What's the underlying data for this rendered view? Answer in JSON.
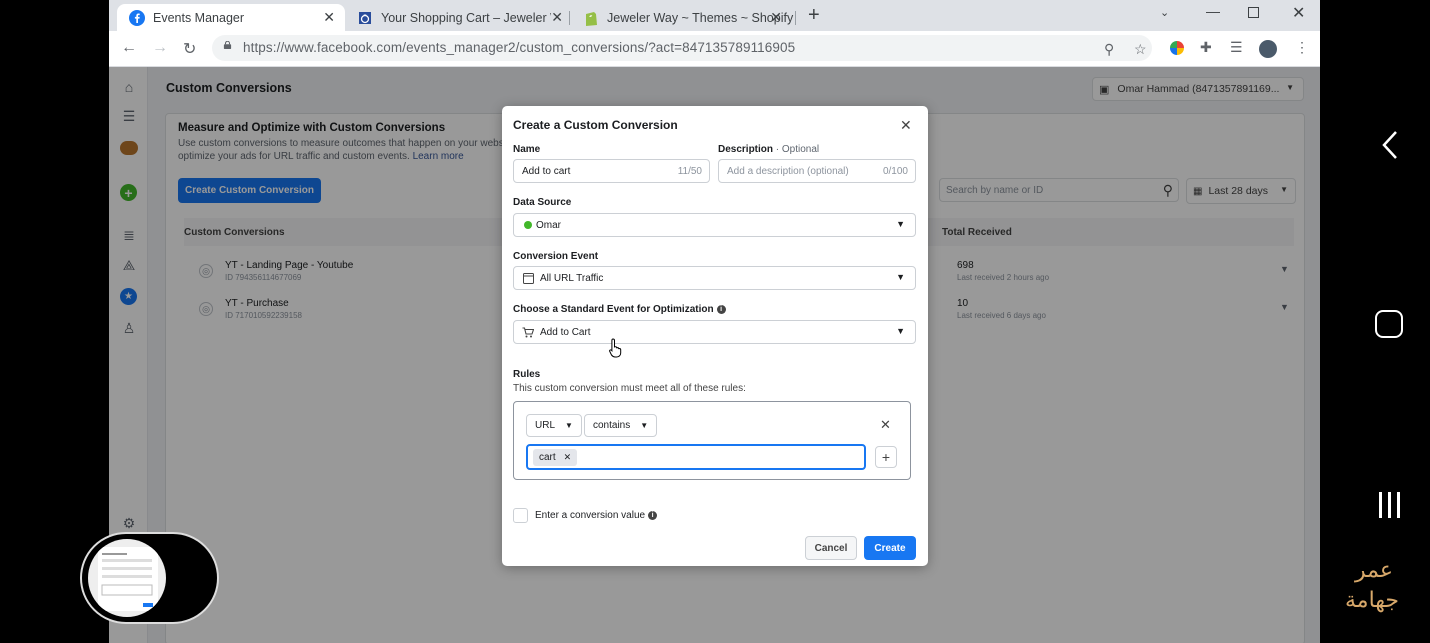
{
  "browser": {
    "tabs": [
      {
        "title": "Events Manager",
        "active": true,
        "icon": "facebook-icon"
      },
      {
        "title": "Your Shopping Cart – Jeweler Wa",
        "active": false,
        "icon": "ring-icon"
      },
      {
        "title": "Jeweler Way ~ Themes ~ Shopify",
        "active": false,
        "icon": "shopify-icon"
      }
    ],
    "url": "https://www.facebook.com/events_manager2/custom_conversions/?act=847135789116905"
  },
  "page": {
    "title": "Custom Conversions",
    "account": "Omar Hammad (8471357891169...",
    "banner": {
      "heading": "Measure and Optimize with Custom Conversions",
      "desc_line1": "Use custom conversions to measure outcomes that happen on your webs",
      "desc_line2": "optimize your ads for URL traffic and custom events.",
      "learn_more": "Learn more"
    },
    "create_button": "Create Custom Conversion",
    "search_placeholder": "Search by name or ID",
    "date_range": "Last 28 days",
    "table": {
      "col_name": "Custom Conversions",
      "col_total": "Total Received",
      "rows": [
        {
          "name": "YT - Landing Page - Youtube",
          "id": "ID 794356114677069",
          "total": "698",
          "last": "Last received 2 hours ago"
        },
        {
          "name": "YT - Purchase",
          "id": "ID 717010592239158",
          "total": "10",
          "last": "Last received 6 days ago"
        }
      ]
    }
  },
  "modal": {
    "title": "Create a Custom Conversion",
    "name_label": "Name",
    "name_value": "Add to cart",
    "name_count": "11/50",
    "desc_label": "Description",
    "desc_optional": " · Optional",
    "desc_placeholder": "Add a description (optional)",
    "desc_count": "0/100",
    "source_label": "Data Source",
    "source_value": "Omar",
    "event_label": "Conversion Event",
    "event_value": "All URL Traffic",
    "standard_label": "Choose a Standard Event for Optimization",
    "standard_value": "Add to Cart",
    "rules_label": "Rules",
    "rules_desc": "This custom conversion must meet all of these rules:",
    "rule_field": "URL",
    "rule_op": "contains",
    "rule_tag": "cart",
    "value_label": "Enter a conversion value",
    "cancel": "Cancel",
    "create": "Create"
  },
  "watermark": {
    "line1": "عمر",
    "line2": "جهامة"
  },
  "colors": {
    "primary": "#1877f2",
    "green": "#42b72a",
    "watermark": "#d8a86a"
  }
}
